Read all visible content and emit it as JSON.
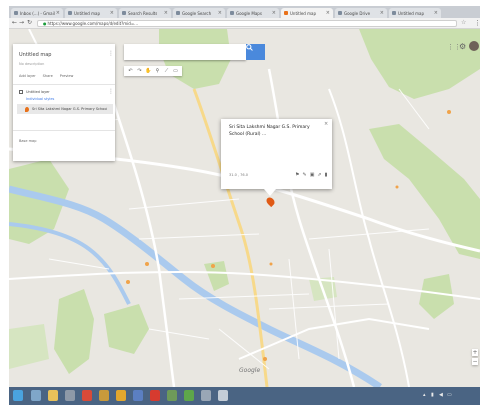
{
  "colors": {
    "map_background": "#e9e7e1",
    "park": "#c9dfad",
    "river": "#aacaee",
    "accent_blue": "#4a89dc",
    "marker": "#e05a15",
    "taskbar": "#4a6483"
  },
  "browser": {
    "tabs": [
      {
        "title": "Inbox (...) - Gmail"
      },
      {
        "title": "Untitled map"
      },
      {
        "title": "Search Results"
      },
      {
        "title": "Google Search"
      },
      {
        "title": "Google Maps"
      },
      {
        "title": "Untitled map",
        "active": true
      },
      {
        "title": "Google Drive"
      },
      {
        "title": "Untitled map"
      }
    ],
    "url": "https://www.google.com/maps/d/edit?mid=..."
  },
  "mymaps": {
    "title": "Untitled map",
    "subtitle": "No description",
    "actions": [
      "Add layer",
      "Share",
      "Preview"
    ],
    "layer": {
      "name": "Untitled layer",
      "style_link": "Individual styles",
      "item": "Sri Sita Lakshmi Nagar G.S. Primary School"
    },
    "base_map_label": "Base map"
  },
  "popup": {
    "title": "Sri Sita Lakshmi Nagar G.S. Primary School (Rural) ...",
    "coords": "31.0 , 76.0"
  },
  "icons": {
    "search": "search-icon",
    "marker": "map-pin-icon",
    "settings": "gear-icon",
    "apps": "apps-grid-icon",
    "close": "close-icon"
  }
}
